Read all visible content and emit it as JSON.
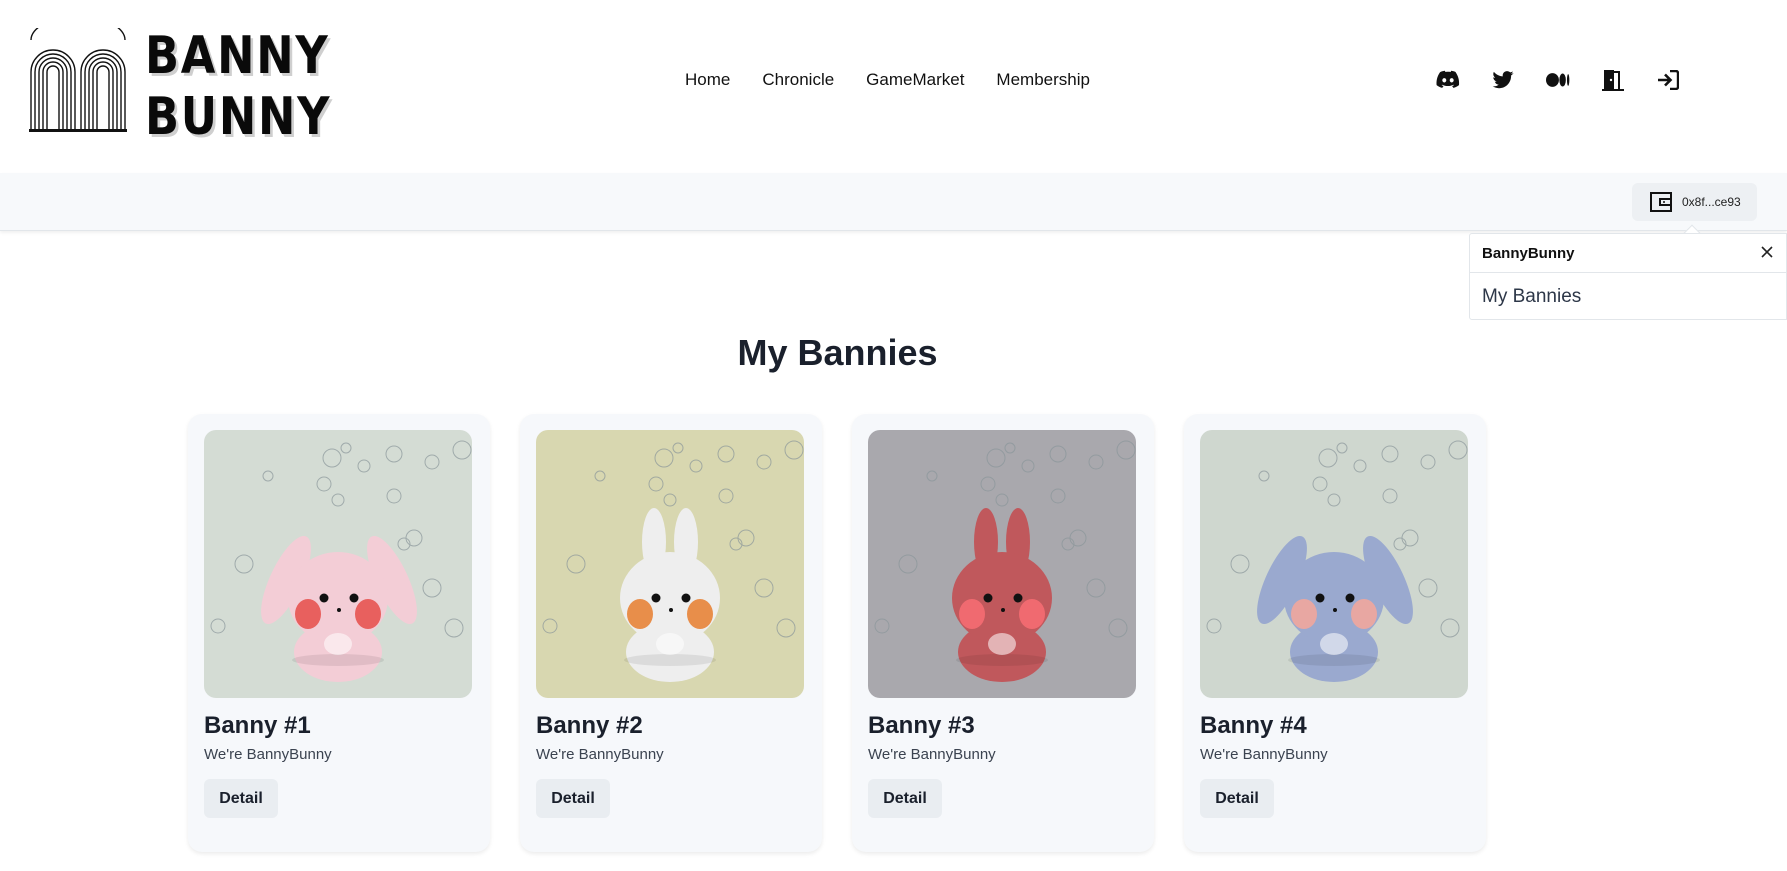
{
  "brand": {
    "line1": "BANNY",
    "line2": "BUNNY"
  },
  "nav": {
    "items": [
      "Home",
      "Chronicle",
      "GameMarket",
      "Membership"
    ]
  },
  "socials": [
    "discord-icon",
    "twitter-icon",
    "medium-icon",
    "door-exit-icon",
    "login-icon"
  ],
  "wallet": {
    "address": "0x8f...ce93",
    "icon": "wallet-icon"
  },
  "dropdown": {
    "title": "BannyBunny",
    "items": [
      "My Bannies"
    ]
  },
  "main": {
    "title": "My Bannies"
  },
  "cards": [
    {
      "title": "Banny #1",
      "subtitle": "We're BannyBunny",
      "button": "Detail",
      "bg": "#d4dcd4",
      "bunny": "#f3cdd6",
      "cheek": "#e8605e"
    },
    {
      "title": "Banny #2",
      "subtitle": "We're BannyBunny",
      "button": "Detail",
      "bg": "#d8d7b0",
      "bunny": "#eeeeee",
      "cheek": "#e88e4a"
    },
    {
      "title": "Banny #3",
      "subtitle": "We're BannyBunny",
      "button": "Detail",
      "bg": "#a9a8ad",
      "bunny": "#c0585c",
      "cheek": "#f06a70"
    },
    {
      "title": "Banny #4",
      "subtitle": "We're BannyBunny",
      "button": "Detail",
      "bg": "#cfd7cf",
      "bunny": "#9aa9cf",
      "cheek": "#e8a7a2"
    }
  ]
}
